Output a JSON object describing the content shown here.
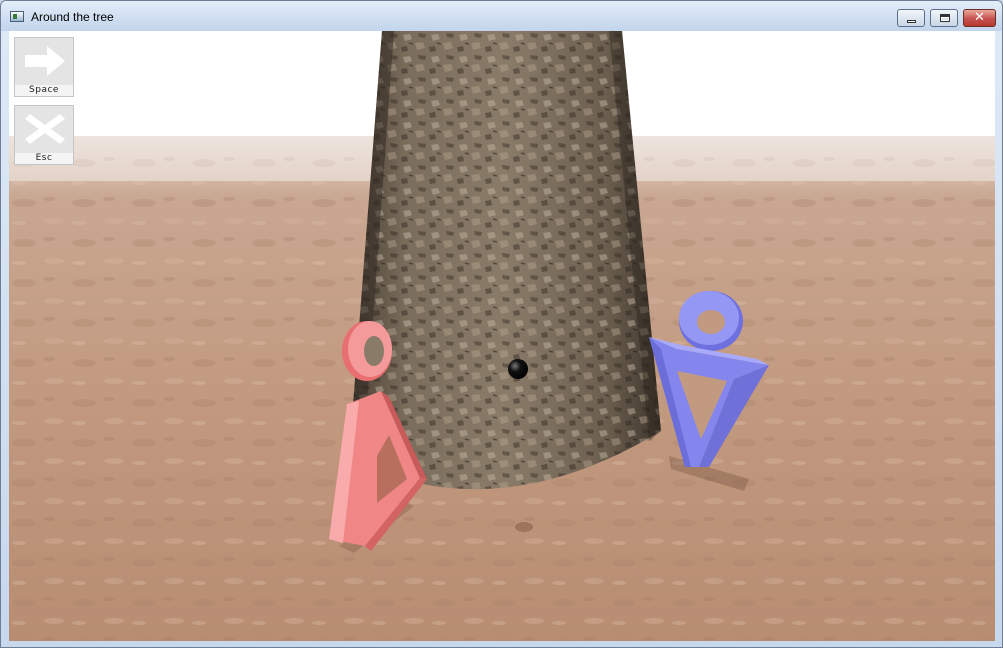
{
  "window": {
    "title": "Around the tree",
    "close_glyph": "✕"
  },
  "controls": {
    "space": {
      "label": "Space",
      "icon": "arrow-right-icon"
    },
    "esc": {
      "label": "Esc",
      "icon": "x-cross-icon"
    }
  },
  "scene": {
    "colors": {
      "sky": "#ffffff",
      "ground": "#c49b82",
      "bark": "#6e6150",
      "red_figure": "#f28a8a",
      "blue_figure": "#8a8cf2",
      "target": "#000000"
    }
  }
}
